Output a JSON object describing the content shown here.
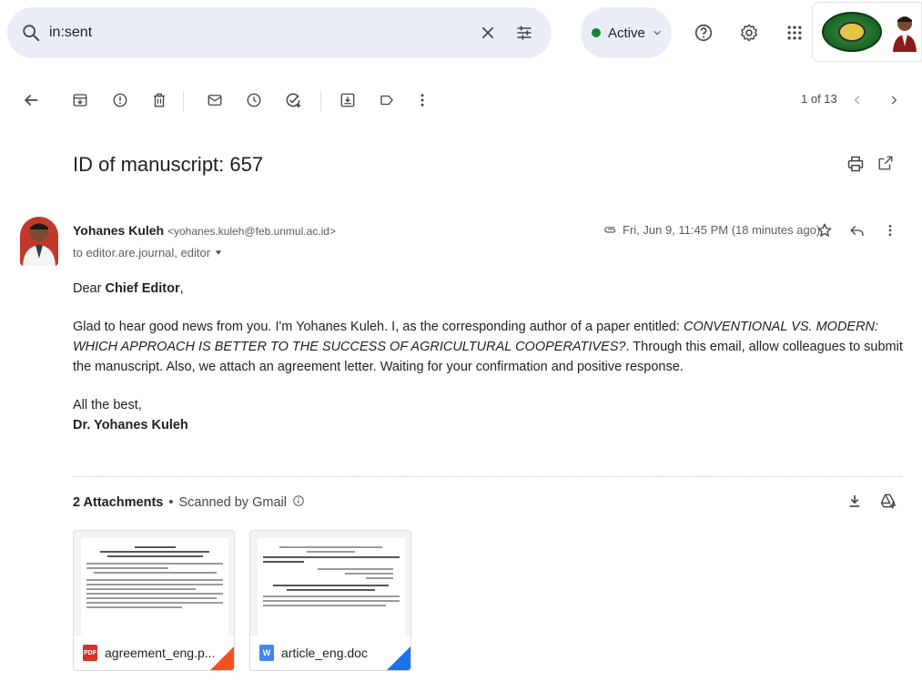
{
  "search": {
    "value": "in:sent"
  },
  "status": {
    "label": "Active"
  },
  "toolbar": {
    "pager": "1 of 13"
  },
  "message": {
    "subject": "ID of manuscript: 657",
    "sender_name": "Yohanes Kuleh",
    "sender_email": "<yohanes.kuleh@feb.unmul.ac.id>",
    "to": "to editor.are.journal, editor",
    "date": "Fri, Jun 9, 11:45 PM (18 minutes ago)",
    "greeting_prefix": "Dear ",
    "greeting_name": "Chief Editor",
    "greeting_suffix": ",",
    "para_start": "Glad to hear good news from you. I'm Yohanes Kuleh. I, as the corresponding author of a paper entitled: ",
    "para_title": "CONVENTIONAL VS. MODERN: WHICH APPROACH IS BETTER TO THE SUCCESS OF AGRICULTURAL COOPERATIVES?",
    "para_end": ". Through this email, allow colleagues to submit the manuscript. Also, we attach an agreement letter. Waiting for your confirmation and positive response.",
    "closing": "All the best,",
    "signature": "Dr. Yohanes Kuleh"
  },
  "attachments": {
    "count_label": "2 Attachments",
    "separator": "•",
    "scanned_label": "Scanned by Gmail",
    "items": [
      {
        "name": "agreement_eng.p...",
        "type": "PDF",
        "type_color": "#d93025",
        "corner_color": "#f4511e"
      },
      {
        "name": "article_eng.doc",
        "type": "W",
        "type_color": "#4285f4",
        "corner_color": "#1a73e8"
      }
    ]
  }
}
